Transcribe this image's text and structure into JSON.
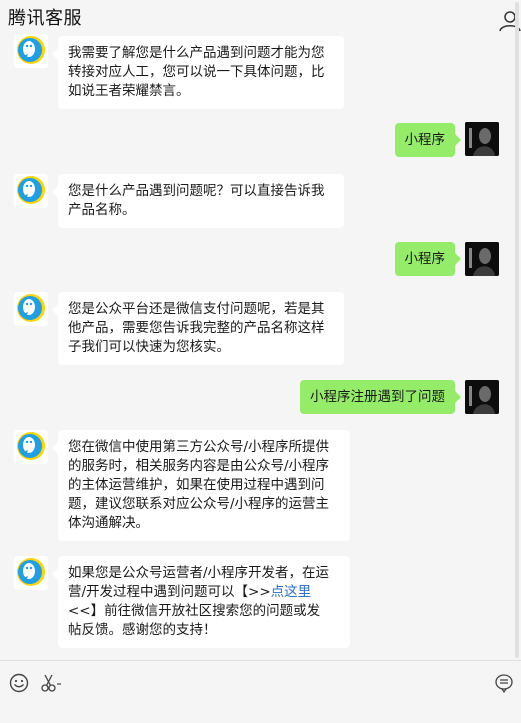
{
  "header": {
    "title": "腾讯客服"
  },
  "messages": [
    {
      "side": "bot",
      "lines": [
        "我需要了解您是什么产品遇到问题才能为您",
        "转接对应人工，您可以说一下具体问题，比",
        "如说王者荣耀禁言。"
      ]
    },
    {
      "side": "user",
      "text": "小程序"
    },
    {
      "side": "bot",
      "lines": [
        "您是什么产品遇到问题呢？可以直接告诉我",
        "产品名称。"
      ]
    },
    {
      "side": "user",
      "text": "小程序"
    },
    {
      "side": "bot",
      "lines": [
        "您是公众平台还是微信支付问题呢，若是其",
        "他产品，需要您告诉我完整的产品名称这样",
        "子我们可以快速为您核实。"
      ]
    },
    {
      "side": "user",
      "text": "小程序注册遇到了问题"
    },
    {
      "side": "bot",
      "lines": [
        "您在微信中使用第三方公众号/小程序所提供",
        "的服务时，相关服务内容是由公众号/小程序",
        "的主体运营维护，如果在使用过程中遇到问",
        "题，建议您联系对应公众号/小程序的运营主",
        "体沟通解决。"
      ]
    },
    {
      "side": "bot",
      "line1": "如果您是公众号运营者/小程序开发者，在运",
      "line2a": "营/开发过程中遇到问题可以【>>",
      "link": "点这里",
      "line3": "<<】前往微信开放社区搜索您的问题或发",
      "line4": "帖反馈。感谢您的支持！"
    }
  ],
  "toolbar": {
    "emoji": "emoji-icon",
    "scissors": "scissors-icon",
    "menu": "chat-menu-icon"
  },
  "colors": {
    "user_bubble": "#95ec69",
    "bot_bubble": "#ffffff",
    "link": "#2a6fcf",
    "background": "#f5f5f5"
  }
}
